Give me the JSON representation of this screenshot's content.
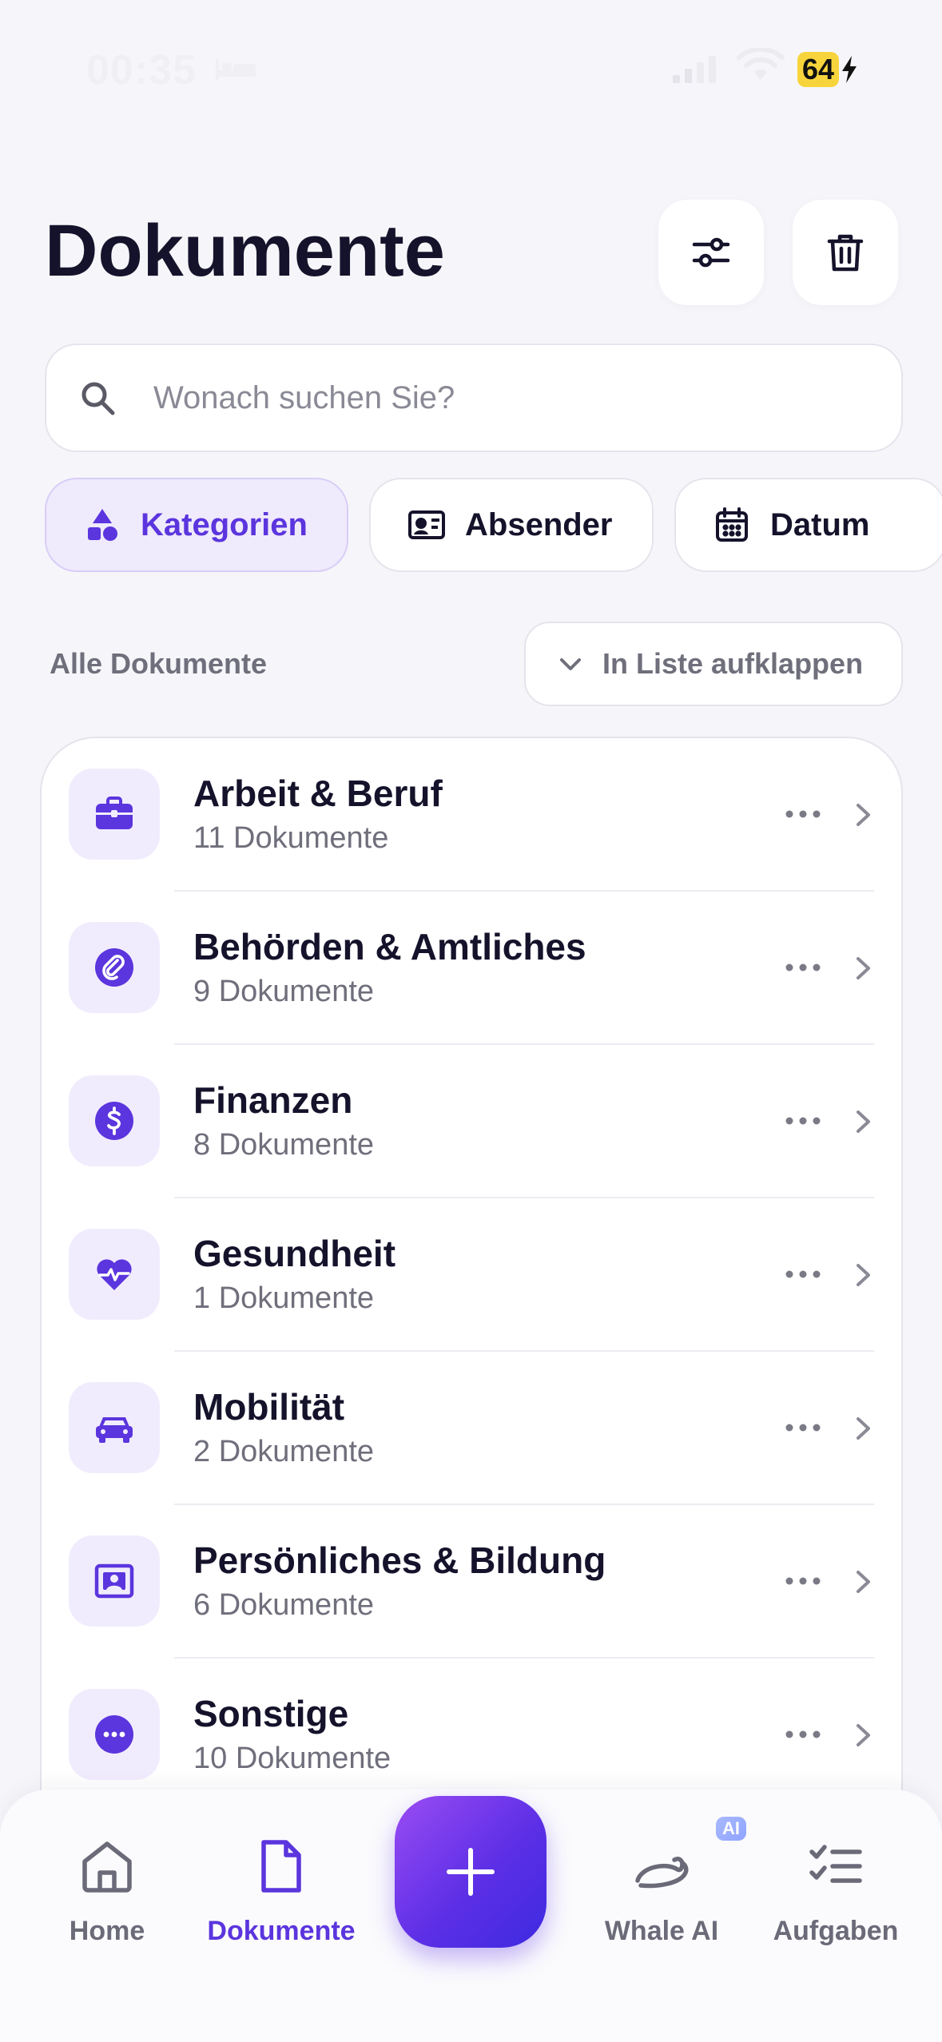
{
  "status_bar": {
    "time": "00:35",
    "battery": "64"
  },
  "header": {
    "title": "Dokumente"
  },
  "search": {
    "placeholder": "Wonach suchen Sie?"
  },
  "chips": [
    {
      "label": "Kategorien",
      "icon": "shapes-icon",
      "active": true
    },
    {
      "label": "Absender",
      "icon": "contact-card-icon",
      "active": false
    },
    {
      "label": "Datum",
      "icon": "calendar-icon",
      "active": false
    }
  ],
  "section": {
    "title": "Alle Dokumente",
    "expand_label": "In Liste aufklappen"
  },
  "categories": [
    {
      "name": "Arbeit & Beruf",
      "count": "11 Dokumente",
      "icon": "briefcase-icon"
    },
    {
      "name": "Behörden & Amtliches",
      "count": "9 Dokumente",
      "icon": "paperclip-icon"
    },
    {
      "name": "Finanzen",
      "count": "8 Dokumente",
      "icon": "dollar-icon"
    },
    {
      "name": "Gesundheit",
      "count": "1 Dokumente",
      "icon": "heartbeat-icon"
    },
    {
      "name": "Mobilität",
      "count": "2 Dokumente",
      "icon": "car-icon"
    },
    {
      "name": "Persönliches & Bildung",
      "count": "6 Dokumente",
      "icon": "portrait-icon"
    },
    {
      "name": "Sonstige",
      "count": "10 Dokumente",
      "icon": "more-circle-icon"
    }
  ],
  "nav": {
    "home": "Home",
    "documents": "Dokumente",
    "whale_ai": "Whale AI",
    "ai_badge": "AI",
    "tasks": "Aufgaben"
  },
  "colors": {
    "accent": "#5b35dd",
    "icon_bg": "#f1ecfd",
    "fab_start": "#9a4cf3",
    "fab_end": "#3d2ae0"
  }
}
